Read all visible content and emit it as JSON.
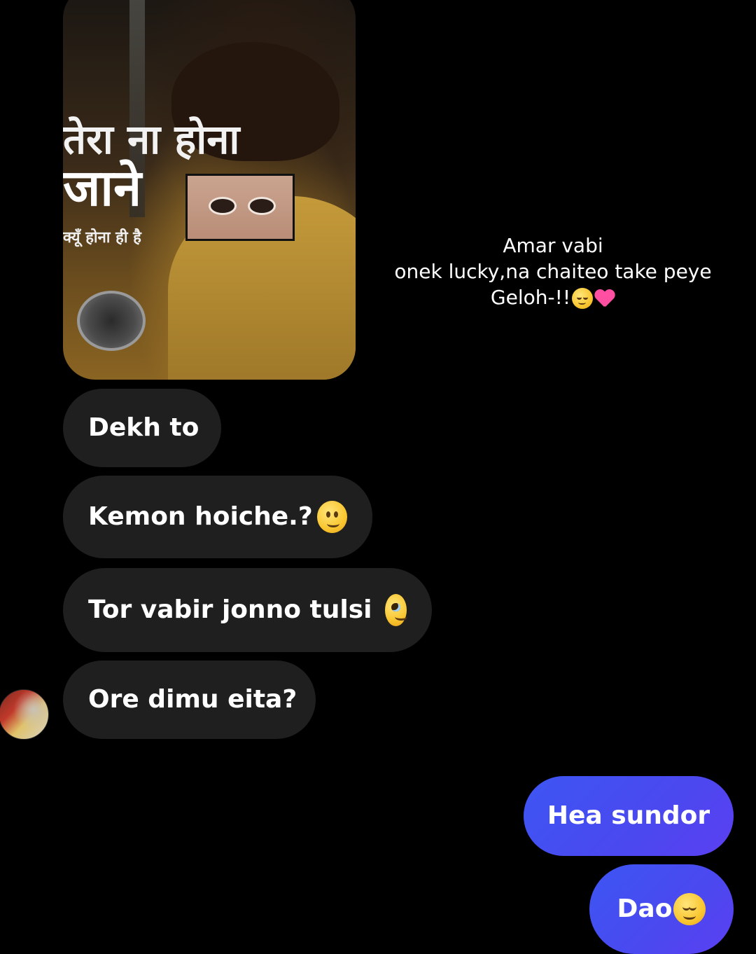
{
  "conversation": {
    "shared_media": {
      "headline_line1": "तेरा ना होना",
      "headline_line2": "जाने",
      "headline_sub": "क्यूँ होना ही है"
    },
    "caption": {
      "line1": "Amar vabi",
      "line2": "onek lucky,na chaiteo take peye",
      "line3": "Geloh-!!"
    },
    "incoming": [
      {
        "text": "Dekh to"
      },
      {
        "text": "Kemon hoiche.?",
        "emoji": "slightly-smiling-face"
      },
      {
        "text": "Tor vabir jonno tulsi ",
        "emoji": "face-holding-back-tears"
      },
      {
        "text": "Ore dimu eita?"
      }
    ],
    "outgoing": [
      {
        "text": "Hea sundor"
      },
      {
        "text": "Dao",
        "emoji": "relieved-face"
      }
    ],
    "colors": {
      "background": "#000000",
      "incoming_bubble": "#1f1f1f",
      "outgoing_bubble": "#4b48ef"
    }
  }
}
